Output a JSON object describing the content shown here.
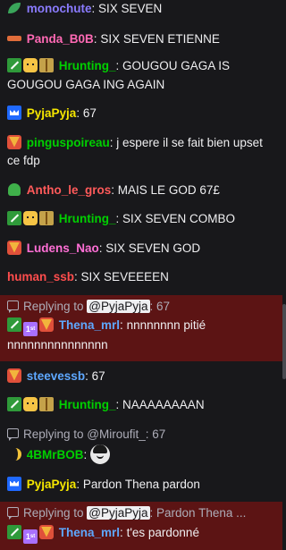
{
  "colors": {
    "background": "#18181b",
    "highlight": "#5c1414",
    "text": "#efeff1",
    "muted": "#adadb8"
  },
  "messages": [
    {
      "badges": [
        "leaf-icon"
      ],
      "user": "monochute",
      "color": "#8a7bff",
      "text": "SIX SEVEN"
    },
    {
      "badges": [
        "gun-icon"
      ],
      "user": "Panda_B0B",
      "color": "#ff69b4",
      "text": "SIX SEVEN ETIENNE"
    },
    {
      "badges": [
        "sword-badge-icon",
        "pikachu-badge-icon",
        "gift-badge-icon"
      ],
      "user": "Hrunting_",
      "color": "#00d000",
      "text": "GOUGOU GAGA IS GOUGOU GAGA ING AGAIN"
    },
    {
      "badges": [
        "crown-badge-icon"
      ],
      "user": "PyjaPyja",
      "color": "#f5e600",
      "text": "67"
    },
    {
      "badges": [
        "vs-badge-icon"
      ],
      "user": "pinguspoireau",
      "color": "#00d000",
      "text": "j espere il se fait bien upset ce fdp"
    },
    {
      "badges": [
        "dino-icon"
      ],
      "user": "Antho_le_gros",
      "color": "#ff5a5a",
      "text": "MAIS LE GOD 67£"
    },
    {
      "badges": [
        "sword-badge-icon",
        "pikachu-badge-icon",
        "gift-badge-icon"
      ],
      "user": "Hrunting_",
      "color": "#00d000",
      "text": "SIX SEVEN COMBO"
    },
    {
      "badges": [
        "vs-badge-icon"
      ],
      "user": "Ludens_Nao",
      "color": "#ff6fd6",
      "text": "SIX SEVEN GOD"
    },
    {
      "badges": [],
      "user": "human_ssb",
      "color": "#ff4d4d",
      "text": "SIX SEVEEEEN"
    },
    {
      "reply": {
        "prefix": "Replying to ",
        "mention": "@PyjaPyja",
        "rest": ": 67"
      },
      "highlight": true,
      "badges": [
        "sword-badge-icon",
        "first-badge-icon",
        "vs-badge-icon"
      ],
      "user": "Thena_mrl",
      "color": "#5ea8ff",
      "text": "nnnnnnnn pitié nnnnnnnnnnnnnnn"
    },
    {
      "badges": [
        "vs-badge-icon"
      ],
      "user": "steevessb",
      "color": "#5ea8ff",
      "text": "67"
    },
    {
      "badges": [
        "sword-badge-icon",
        "pikachu-badge-icon",
        "gift-badge-icon"
      ],
      "user": "Hrunting_",
      "color": "#00d000",
      "text": "NAAAAAAAAN"
    },
    {
      "reply": {
        "prefix": "Replying to ",
        "mention": "@Miroufit_",
        "rest": ": 67",
        "plain": true
      },
      "badges": [
        "banana-icon"
      ],
      "user": "4BMrBOB",
      "color": "#00d000",
      "text": "",
      "emote": "face-emote"
    },
    {
      "badges": [
        "crown-badge-icon"
      ],
      "user": "PyjaPyja",
      "color": "#f5e600",
      "text": "Pardon Thena pardon"
    },
    {
      "reply": {
        "prefix": "Replying to ",
        "mention": "@PyjaPyja",
        "rest": ": Pardon Thena ..."
      },
      "highlight": true,
      "badges": [
        "sword-badge-icon",
        "first-badge-icon",
        "vs-badge-icon"
      ],
      "user": "Thena_mrl",
      "color": "#5ea8ff",
      "text": "t'es pardonné"
    }
  ]
}
